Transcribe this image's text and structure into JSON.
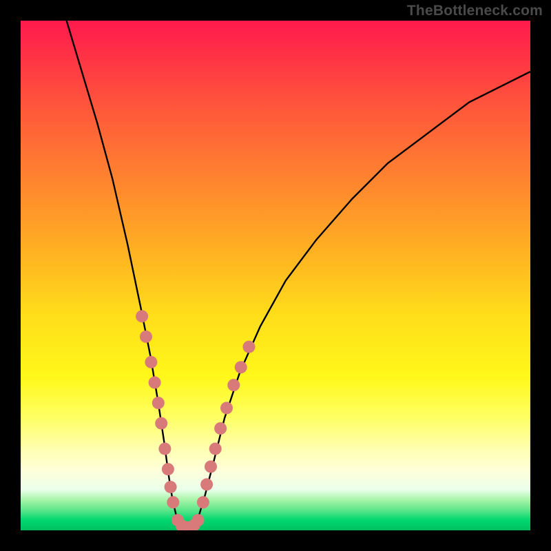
{
  "watermark": "TheBottleneck.com",
  "chart_data": {
    "type": "line",
    "title": "",
    "xlabel": "",
    "ylabel": "",
    "xlim": [
      0,
      100
    ],
    "ylim": [
      0,
      100
    ],
    "grid": false,
    "legend": false,
    "series": [
      {
        "name": "curve",
        "x": [
          9,
          12,
          15,
          18,
          21,
          23.5,
          25.5,
          27,
          28.2,
          29,
          29.8,
          30.5,
          31.2,
          32,
          33,
          34,
          35,
          36.2,
          38,
          40,
          43,
          47,
          52,
          58,
          65,
          72,
          80,
          88,
          96,
          100
        ],
        "y": [
          100,
          90,
          80,
          69,
          56,
          44,
          34,
          25,
          17,
          11,
          6,
          3,
          1.2,
          0.5,
          0.5,
          1.2,
          3,
          7,
          14,
          22,
          31,
          40,
          49,
          57,
          65,
          72,
          78,
          84,
          88,
          90
        ]
      }
    ],
    "markers": {
      "left_branch": [
        {
          "x": 23.8,
          "y": 42
        },
        {
          "x": 24.6,
          "y": 38
        },
        {
          "x": 25.6,
          "y": 33
        },
        {
          "x": 26.3,
          "y": 29
        },
        {
          "x": 27.0,
          "y": 25
        },
        {
          "x": 27.6,
          "y": 21
        },
        {
          "x": 28.3,
          "y": 16
        },
        {
          "x": 28.9,
          "y": 12
        },
        {
          "x": 29.4,
          "y": 8.5
        },
        {
          "x": 29.9,
          "y": 5.5
        }
      ],
      "bottom": [
        {
          "x": 30.8,
          "y": 2.0
        },
        {
          "x": 31.6,
          "y": 0.9
        },
        {
          "x": 32.4,
          "y": 0.6
        },
        {
          "x": 33.2,
          "y": 0.6
        },
        {
          "x": 34.0,
          "y": 1.0
        },
        {
          "x": 34.8,
          "y": 2.0
        }
      ],
      "right_branch": [
        {
          "x": 35.8,
          "y": 5.5
        },
        {
          "x": 36.5,
          "y": 9
        },
        {
          "x": 37.3,
          "y": 12.5
        },
        {
          "x": 38.2,
          "y": 16
        },
        {
          "x": 39.2,
          "y": 20
        },
        {
          "x": 40.4,
          "y": 24
        },
        {
          "x": 41.8,
          "y": 28.5
        },
        {
          "x": 43.2,
          "y": 32
        },
        {
          "x": 44.8,
          "y": 36
        }
      ]
    },
    "marker_color": "#d87a7a",
    "marker_radius_px": 9
  }
}
